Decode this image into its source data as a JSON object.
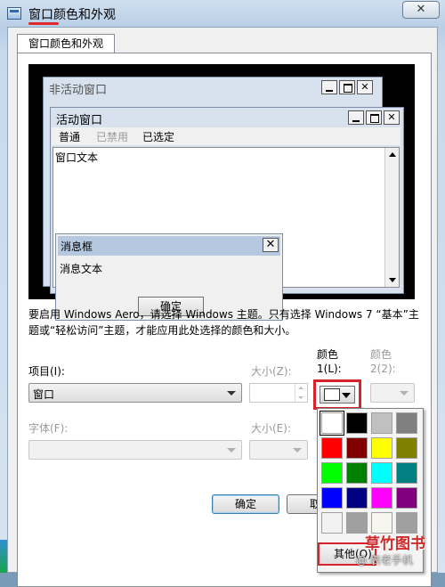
{
  "window": {
    "title": "窗口颜色和外观",
    "close_glyph": "✕"
  },
  "tab": {
    "label": "窗口颜色和外观"
  },
  "preview": {
    "inactive_title": "非活动窗口",
    "active_title": "活动窗口",
    "menu": [
      "普通",
      "已禁用",
      "已选定"
    ],
    "window_text": "窗口文本",
    "msgbox_title": "消息框",
    "msgbox_text": "消息文本",
    "msgbox_ok": "确定",
    "close_glyph": "✕"
  },
  "info": "要启用 Windows Aero，请选择 Windows 主题。只有选择 Windows 7 “基本”主题或“轻松访问”主题，才能应用此处选择的颜色和大小。",
  "form": {
    "item_label": "项目(I):",
    "item_value": "窗口",
    "size_label": "大小(Z):",
    "color1_label": "颜色 1(L):",
    "color2_label": "颜色 2(2):",
    "font_label": "字体(F):",
    "font_size_label": "大小(E):"
  },
  "palette": {
    "colors": [
      "#ffffff",
      "#000000",
      "#c0c0c0",
      "#808080",
      "#ff0000",
      "#800000",
      "#ffff00",
      "#808000",
      "#00ff00",
      "#008000",
      "#00ffff",
      "#008080",
      "#0000ff",
      "#000080",
      "#ff00ff",
      "#800080",
      "#f2f2f2",
      "#a0a0a0",
      "#f6f6ee",
      "#a0a0a0"
    ],
    "selected_index": 0,
    "other_label": "其他(O)..."
  },
  "buttons": {
    "ok": "确定",
    "cancel": "取消"
  },
  "watermark": {
    "brand": "草竹图书",
    "sub": "@ 表老手机"
  },
  "accent": "#d9232a"
}
